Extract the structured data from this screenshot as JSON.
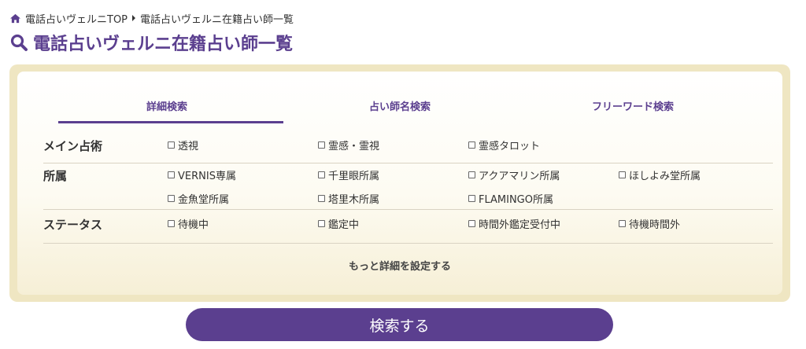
{
  "breadcrumb": {
    "home": "電話占いヴェルニTOP",
    "current": "電話占いヴェルニ在籍占い師一覧"
  },
  "title": "電話占いヴェルニ在籍占い師一覧",
  "tabs": [
    {
      "label": "詳細検索",
      "active": true
    },
    {
      "label": "占い師名検索",
      "active": false
    },
    {
      "label": "フリーワード検索",
      "active": false
    }
  ],
  "filters": {
    "main_skill": {
      "label": "メイン占術",
      "options": [
        "透視",
        "霊感・霊視",
        "霊感タロット"
      ]
    },
    "affiliation": {
      "label": "所属",
      "options": [
        "VERNIS専属",
        "千里眼所属",
        "アクアマリン所属",
        "ほしよみ堂所属",
        "金魚堂所属",
        "塔里木所属",
        "FLAMINGO所属"
      ]
    },
    "status": {
      "label": "ステータス",
      "options": [
        "待機中",
        "鑑定中",
        "時間外鑑定受付中",
        "待機時間外"
      ]
    }
  },
  "more_settings": "もっと詳細を設定する",
  "search_button": "検索する",
  "colors": {
    "accent": "#5b3f8f",
    "panel_frame": "#efe6c2"
  }
}
